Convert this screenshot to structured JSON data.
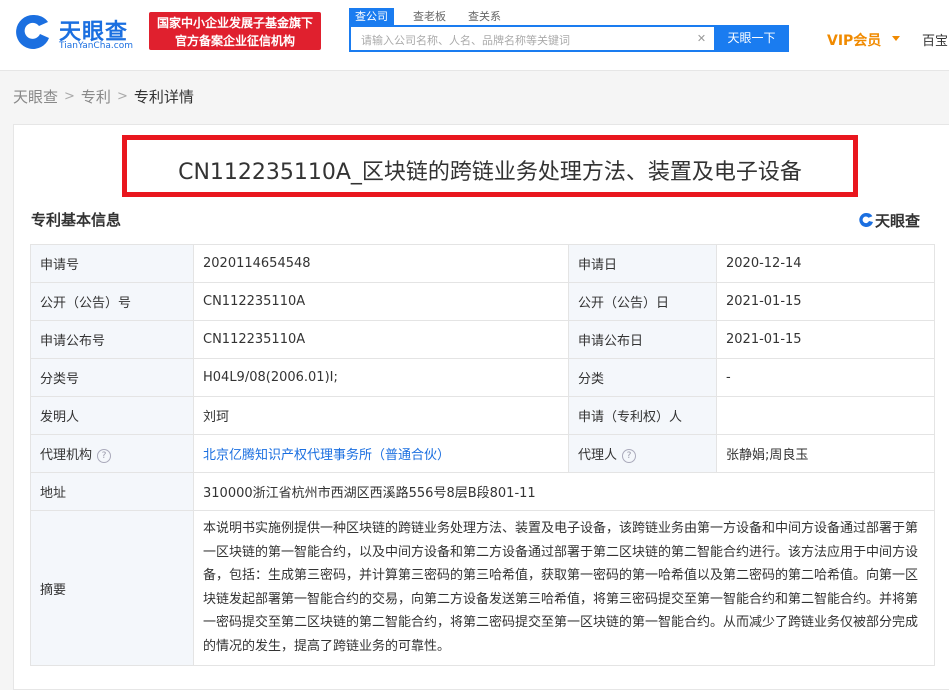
{
  "header": {
    "logo_text": "天眼查",
    "logo_sub": "TianYanCha.com",
    "badge_line1": "国家中小企业发展子基金旗下",
    "badge_line2": "官方备案企业征信机构",
    "search_tabs": [
      "查公司",
      "查老板",
      "查关系"
    ],
    "search_placeholder": "请输入公司名称、人名、品牌名称等关键词",
    "search_button": "天眼一下",
    "vip_label": "VIP会员",
    "baishi_label": "百宝"
  },
  "breadcrumb": {
    "home": "天眼查",
    "section": "专利",
    "current": "专利详情"
  },
  "patent": {
    "title": "CN112235110A_区块链的跨链业务处理方法、装置及电子设备",
    "section_title": "专利基本信息",
    "brand_mark": "天眼查",
    "rows": [
      {
        "k1": "申请号",
        "v1": "2020114654548",
        "k2": "申请日",
        "v2": "2020-12-14"
      },
      {
        "k1": "公开（公告）号",
        "v1": "CN112235110A",
        "k2": "公开（公告）日",
        "v2": "2021-01-15"
      },
      {
        "k1": "申请公布号",
        "v1": "CN112235110A",
        "k2": "申请公布日",
        "v2": "2021-01-15"
      },
      {
        "k1": "分类号",
        "v1": "H04L9/08(2006.01)I;",
        "k2": "分类",
        "v2": "-"
      },
      {
        "k1": "发明人",
        "v1": "刘珂",
        "k2": "申请（专利权）人",
        "v2": ""
      },
      {
        "k1": "代理机构",
        "v1": "北京亿腾知识产权代理事务所（普通合伙）",
        "k2": "代理人",
        "v2": "张静娟;周良玉"
      }
    ],
    "address_label": "地址",
    "address": "310000浙江省杭州市西湖区西溪路556号8层B段801-11",
    "abstract_label": "摘要",
    "abstract": "本说明书实施例提供一种区块链的跨链业务处理方法、装置及电子设备，该跨链业务由第一方设备和中间方设备通过部署于第一区块链的第一智能合约，以及中间方设备和第二方设备通过部署于第二区块链的第二智能合约进行。该方法应用于中间方设备，包括：生成第三密码，并计算第三密码的第三哈希值，获取第一密码的第一哈希值以及第二密码的第二哈希值。向第一区块链发起部署第一智能合约的交易，向第二方设备发送第三哈希值，将第三密码提交至第一智能合约和第二智能合约。并将第一密码提交至第二区块链的第二智能合约，将第二密码提交至第一区块链的第一智能合约。从而减少了跨链业务仅被部分完成的情况的发生，提高了跨链业务的可靠性。"
  },
  "colors": {
    "brand_blue": "#1a7cf0",
    "badge_red": "#e0202e",
    "highlight_red": "#e9161e",
    "vip_orange": "#f08a00",
    "link_blue": "#1b6fe0"
  },
  "icons": {
    "logo": "tianyancha-logo-icon",
    "clear": "clear-icon",
    "vip_dropdown": "chevron-down-icon",
    "help": "question-mark-icon"
  }
}
